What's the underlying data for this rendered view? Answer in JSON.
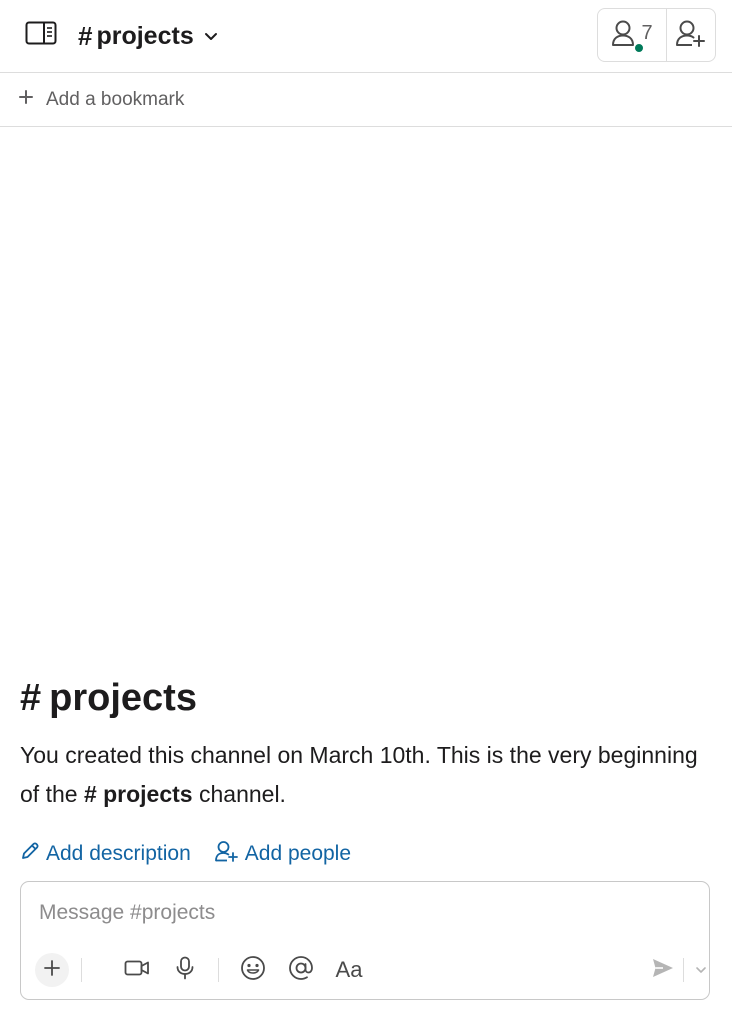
{
  "header": {
    "channel_hash": "#",
    "channel_name": "projects",
    "member_count": "7",
    "icons": {
      "sidebar_toggle": "sidebar-panel-icon",
      "dropdown": "chevron-down-icon",
      "members": "person-icon",
      "add_member": "person-add-icon"
    },
    "status_color": "#007a5a"
  },
  "bookmarks": {
    "add_label": "Add a bookmark",
    "icon": "plus-icon"
  },
  "intro": {
    "hash": "#",
    "title": "projects",
    "text_before": "You created this channel on March 10th. This is the very beginning of the ",
    "channel_ref": "# projects",
    "text_after": " channel.",
    "actions": {
      "add_description": "Add description",
      "add_people": "Add people"
    },
    "link_color": "#1264a3"
  },
  "composer": {
    "placeholder": "Message #projects",
    "format_label": "Aa",
    "tools": [
      "plus-icon",
      "video-icon",
      "microphone-icon",
      "emoji-icon",
      "mention-icon",
      "formatting-icon",
      "send-icon",
      "chevron-down-icon"
    ]
  }
}
